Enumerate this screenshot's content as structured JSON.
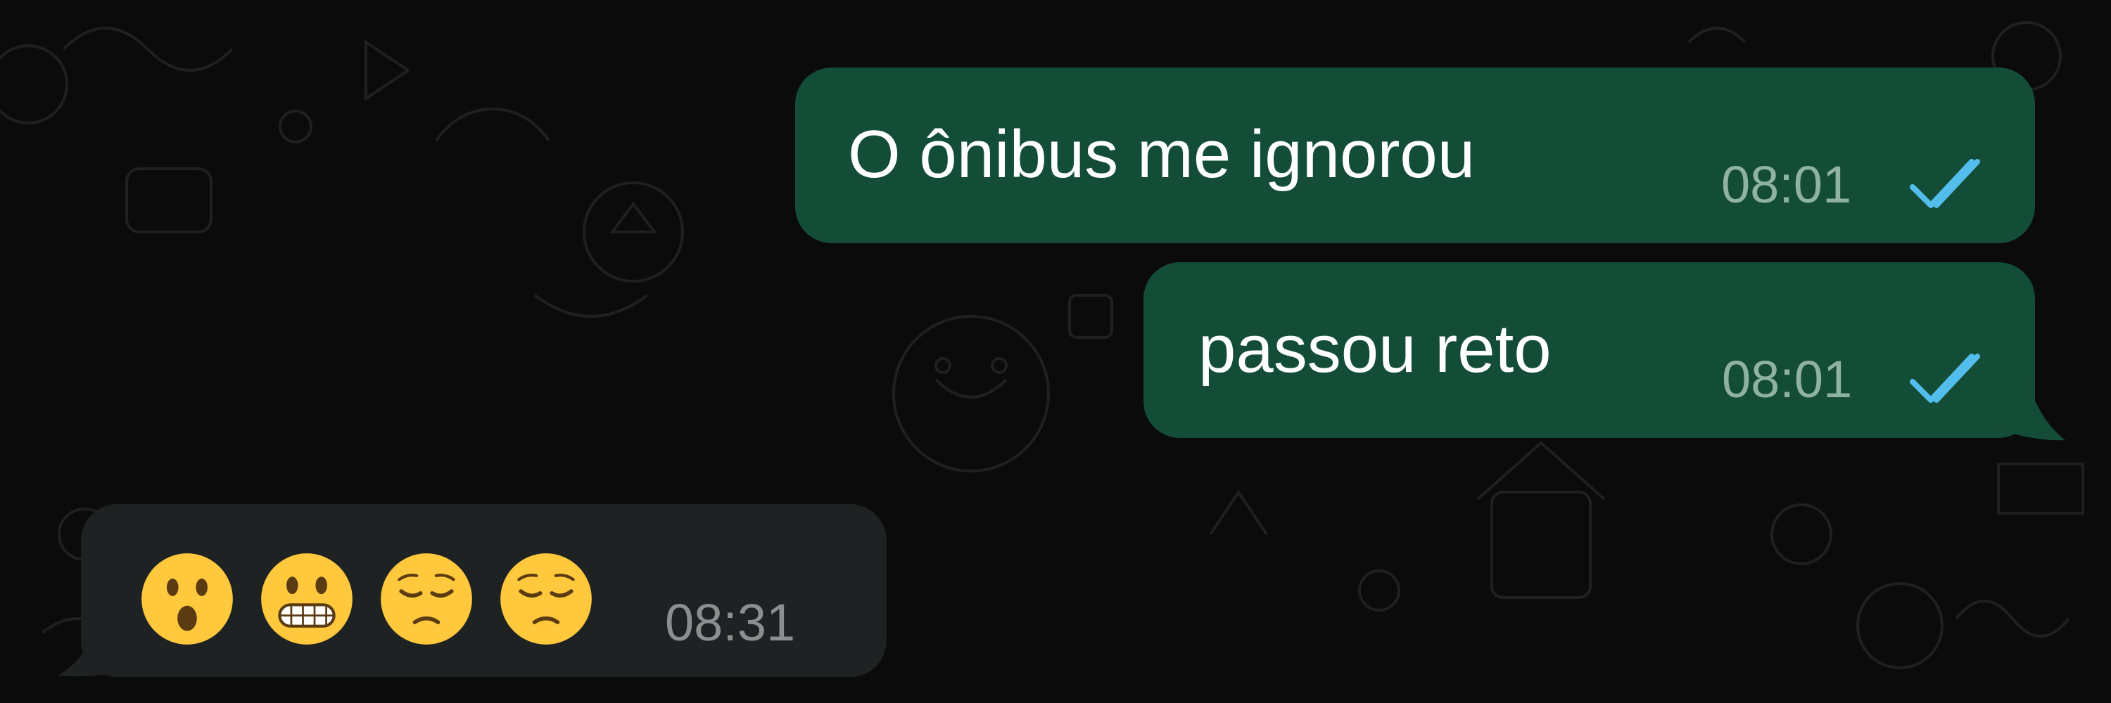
{
  "messages": [
    {
      "direction": "outgoing",
      "text": "O ônibus me ignorou",
      "time": "08:01",
      "status_icon": "double-check-read-icon"
    },
    {
      "direction": "outgoing",
      "text": "passou reto",
      "time": "08:01",
      "status_icon": "double-check-read-icon"
    },
    {
      "direction": "incoming",
      "emojis": [
        "hushed-face-icon",
        "grimacing-face-icon",
        "pensive-face-icon",
        "pensive-face-icon"
      ],
      "time": "08:31"
    }
  ],
  "colors": {
    "background": "#0b0b0b",
    "outgoing_bubble": "#144d37",
    "incoming_bubble": "#1f2222",
    "read_ticks": "#53bdeb",
    "emoji_yellow": "#ffc83d"
  }
}
